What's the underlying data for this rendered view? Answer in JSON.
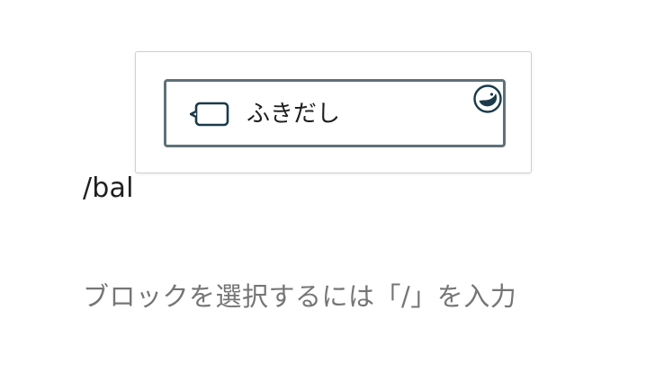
{
  "editor": {
    "typed_text": "/bal",
    "placeholder": "ブロックを選択するには「/」を入力"
  },
  "autocomplete": {
    "items": [
      {
        "label": "ふきだし",
        "icon": "speech-bubble-icon",
        "badge_icon": "plugin-badge-icon"
      }
    ]
  },
  "colors": {
    "selected_border": "#5f7078",
    "icon_stroke": "#1b3b4a",
    "placeholder_text": "#757575",
    "text": "#1e1e1e"
  }
}
